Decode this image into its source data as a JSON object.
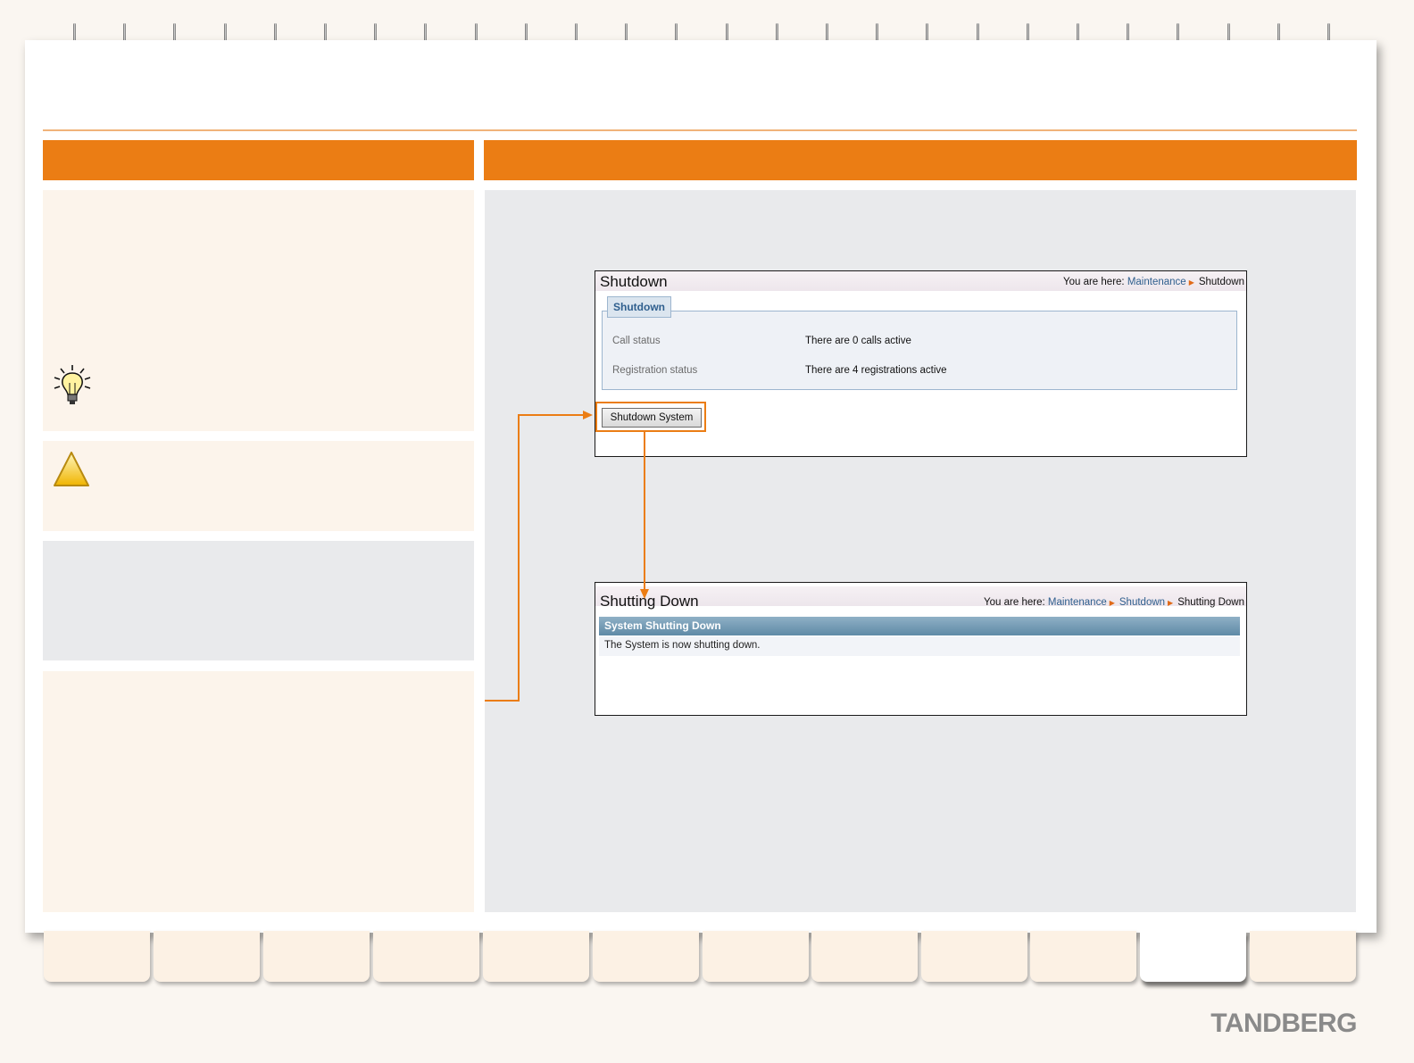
{
  "screen1": {
    "title": "Shutdown",
    "breadcrumb": {
      "prefix": "You are here:",
      "link1": "Maintenance",
      "current": "Shutdown"
    },
    "fieldset_legend": "Shutdown",
    "rows": [
      {
        "label": "Call status",
        "value": "There are 0 calls active"
      },
      {
        "label": "Registration status",
        "value": "There are 4 registrations active"
      }
    ],
    "button": "Shutdown System"
  },
  "screen2": {
    "title": "Shutting Down",
    "breadcrumb": {
      "prefix": "You are here:",
      "link1": "Maintenance",
      "link2": "Shutdown",
      "current": "Shutting Down"
    },
    "banner": "System Shutting Down",
    "message": "The System is now shutting down."
  },
  "logo": "TANDBERG",
  "icons": {
    "tip": "lightbulb-icon",
    "warning": "warning-triangle-icon",
    "crumb_separator": "triangle-right-icon"
  },
  "colors": {
    "accent": "#eb7d14",
    "cream": "#fcf4eb",
    "grey_panel": "#e9eaec",
    "link": "#2f5f8e"
  }
}
